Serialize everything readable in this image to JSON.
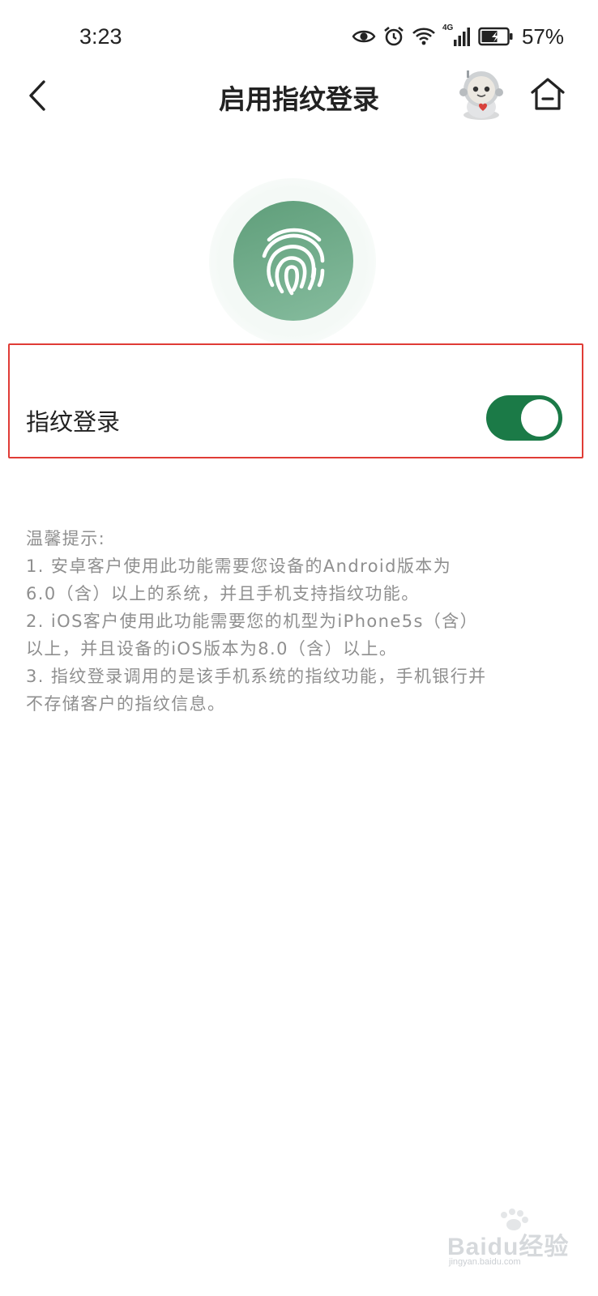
{
  "status_bar": {
    "time": "3:23",
    "network": "4G",
    "battery": "57%"
  },
  "header": {
    "title": "启用指纹登录",
    "back_icon": "chevron-left-icon",
    "home_icon": "home-icon"
  },
  "fingerprint": {
    "icon": "fingerprint-icon",
    "color": "#6aa886"
  },
  "setting": {
    "label": "指纹登录",
    "enabled": true,
    "switch_color": "#1b7a47",
    "highlight_color": "#e03c36"
  },
  "tips": {
    "lines": [
      "温馨提示:",
      "1. 安卓客户使用此功能需要您设备的Android版本为",
      "6.0（含）以上的系统，并且手机支持指纹功能。",
      "2. iOS客户使用此功能需要您的机型为iPhone5s（含）",
      "以上，并且设备的iOS版本为8.0（含）以上。",
      "3. 指纹登录调用的是该手机系统的指纹功能，手机银行并",
      "不存储客户的指纹信息。"
    ]
  },
  "watermark": {
    "text": "Baidu经验",
    "subtext": "jingyan.baidu.com"
  }
}
